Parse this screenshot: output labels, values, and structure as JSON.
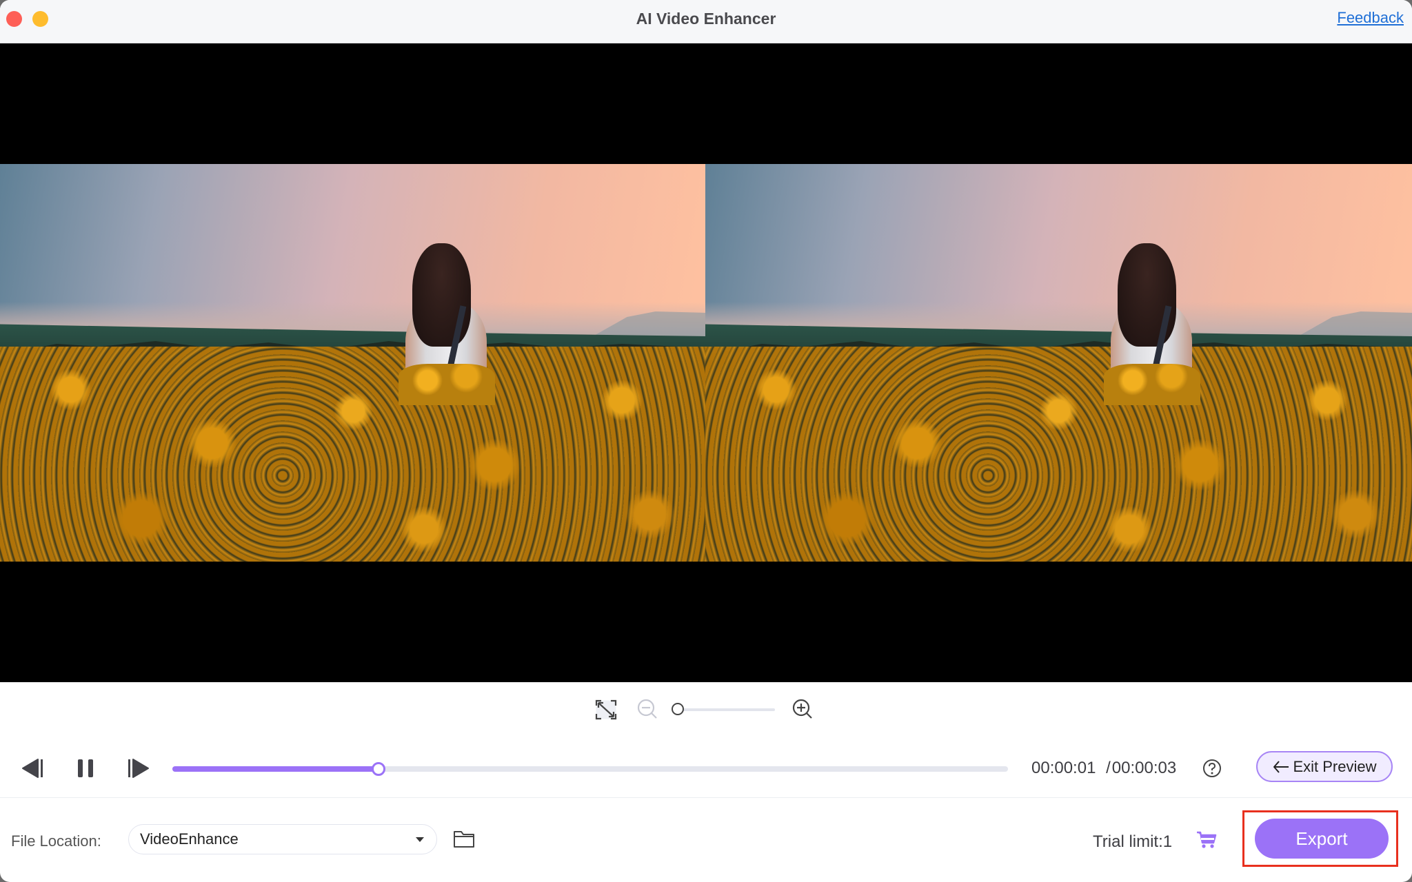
{
  "window": {
    "title": "AI Video Enhancer",
    "feedback_link": "Feedback"
  },
  "preview": {
    "left_pane": "original",
    "right_pane": "enhanced",
    "scene_description": "Woman with long dark hair standing in a field of yellow flowers at sunset"
  },
  "zoom_controls": {
    "fit_icon": "fit-screen-icon",
    "zoom_out_icon": "zoom-out-icon",
    "zoom_in_icon": "zoom-in-icon",
    "zoom_level_fraction": 0.0
  },
  "playback": {
    "prev_frame_icon": "step-back-icon",
    "pause_icon": "pause-icon",
    "next_frame_icon": "step-forward-icon",
    "progress_fraction": 0.247,
    "current_time": "00:00:01",
    "separator": "/",
    "total_time": "00:00:03",
    "help_icon": "help-icon",
    "exit_preview_label": "Exit Preview"
  },
  "bottom": {
    "file_location_label": "File Location:",
    "file_location_value": "VideoEnhance",
    "trial_limit": "Trial limit:1",
    "export_label": "Export"
  },
  "colors": {
    "accent": "#9b72f7",
    "feedback_link": "#1f6fd6",
    "highlight_box": "#e8301e",
    "close": "#fe5f57",
    "minimize": "#febc2e"
  }
}
